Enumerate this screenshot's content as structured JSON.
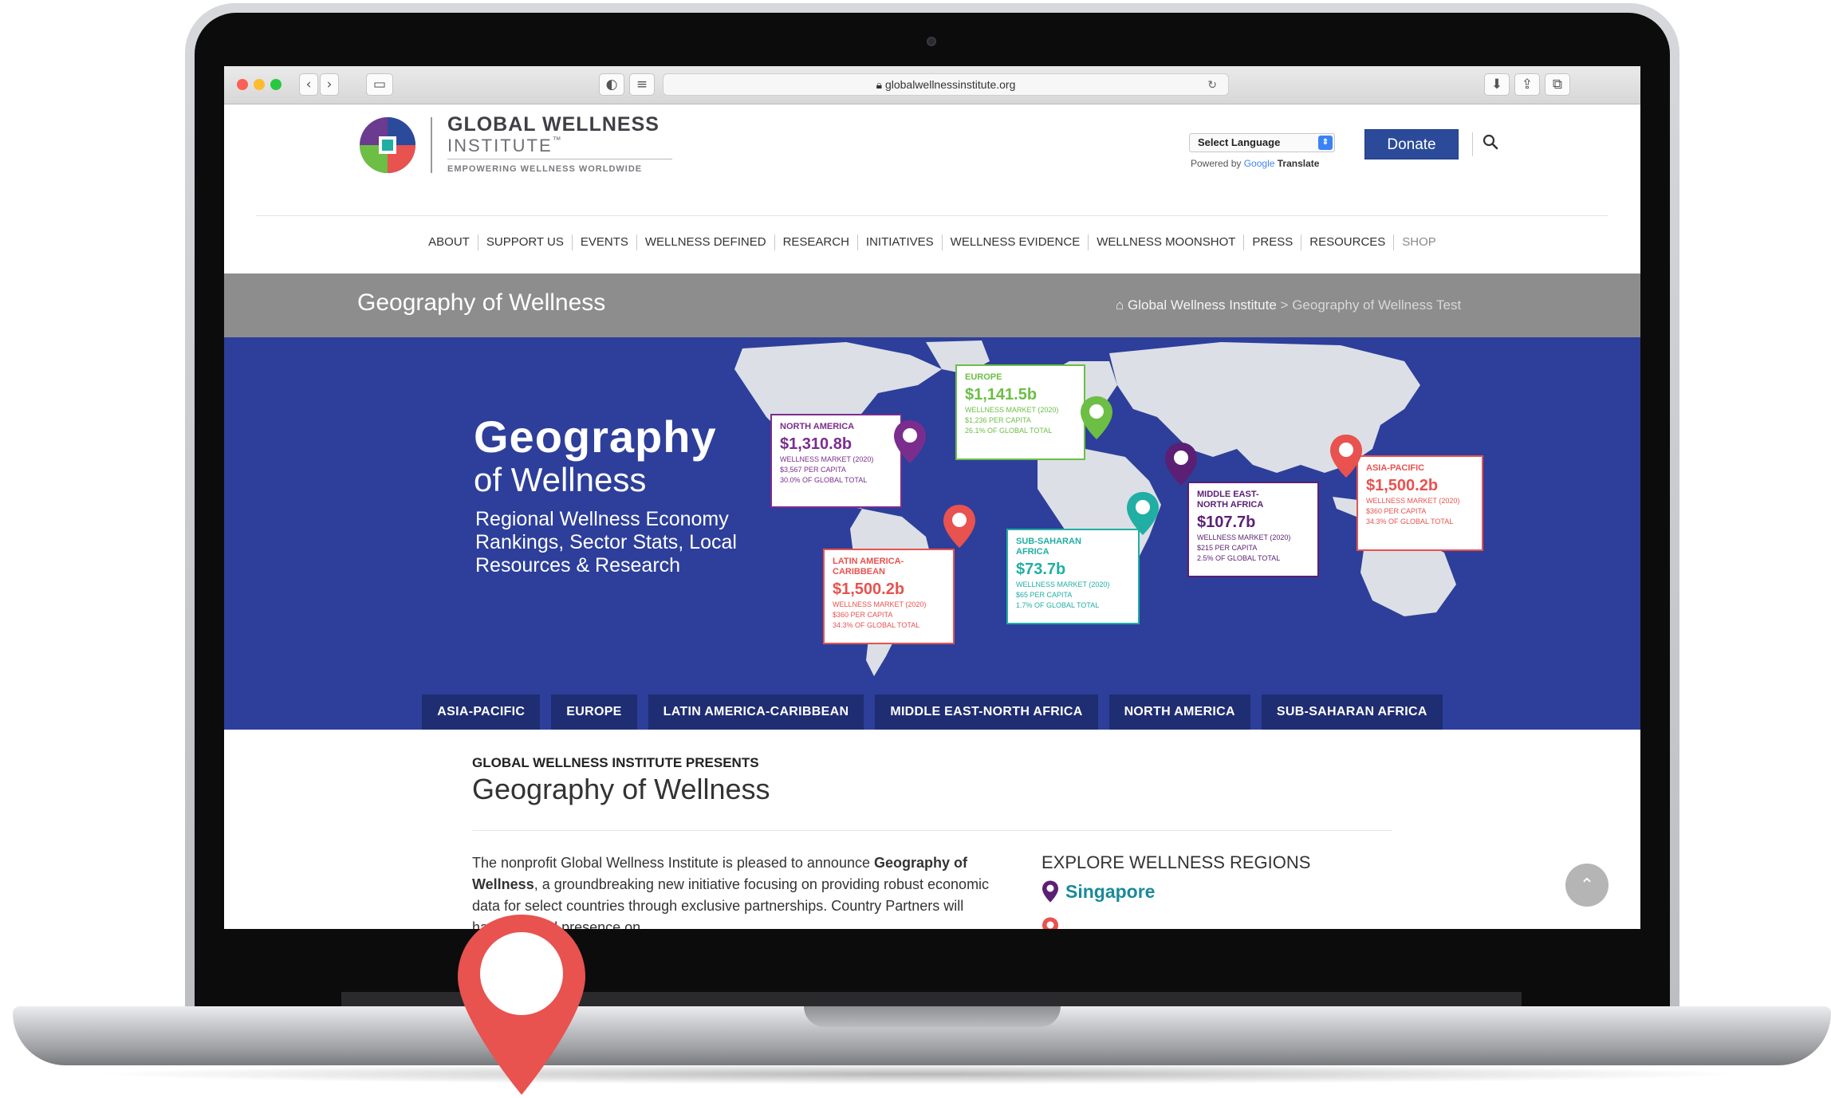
{
  "browser": {
    "url": "globalwellnessinstitute.org"
  },
  "header": {
    "logo_title": "GLOBAL WELLNESS",
    "logo_sub": "INSTITUTE",
    "logo_trademark": "™",
    "tagline": "EMPOWERING WELLNESS WORLDWIDE",
    "language_select": "Select Language",
    "powered_by": "Powered by",
    "google": "Google",
    "translate": "Translate",
    "donate": "Donate"
  },
  "nav": [
    "ABOUT",
    "SUPPORT US",
    "EVENTS",
    "WELLNESS DEFINED",
    "RESEARCH",
    "INITIATIVES",
    "WELLNESS EVIDENCE",
    "WELLNESS MOONSHOT",
    "PRESS",
    "RESOURCES",
    "SHOP"
  ],
  "title_bar": {
    "title": "Geography of Wellness",
    "crumb_home": "Global Wellness Institute",
    "crumb_sep": ">",
    "crumb_current": "Geography of Wellness Test"
  },
  "hero": {
    "title": "Geography",
    "subtitle": "of Wellness",
    "description": "Regional Wellness Economy Rankings, Sector Stats, Local Resources & Research",
    "cards": [
      {
        "region": "NORTH AMERICA",
        "amount": "$1,310.8b",
        "market": "WELLNESS MARKET (2020)",
        "per_capita": "$3,567 PER CAPITA",
        "share": "30.0% OF GLOBAL TOTAL",
        "color": "#7b2d8e"
      },
      {
        "region": "EUROPE",
        "amount": "$1,141.5b",
        "market": "WELLNESS MARKET (2020)",
        "per_capita": "$1,236 PER CAPITA",
        "share": "26.1% OF GLOBAL TOTAL",
        "color": "#6cbe45"
      },
      {
        "region": "MIDDLE EAST-NORTH AFRICA",
        "amount": "$107.7b",
        "market": "WELLNESS MARKET (2020)",
        "per_capita": "$215 PER CAPITA",
        "share": "2.5% OF GLOBAL TOTAL",
        "color": "#5b1f74"
      },
      {
        "region": "ASIA-PACIFIC",
        "amount": "$1,500.2b",
        "market": "WELLNESS MARKET (2020)",
        "per_capita": "$360 PER CAPITA",
        "share": "34.3% OF GLOBAL TOTAL",
        "color": "#e8524f"
      },
      {
        "region": "LATIN AMERICA-CARIBBEAN",
        "amount": "$1,500.2b",
        "market": "WELLNESS MARKET (2020)",
        "per_capita": "$360 PER CAPITA",
        "share": "34.3% OF GLOBAL TOTAL",
        "color": "#e8524f"
      },
      {
        "region": "SUB-SAHARAN AFRICA",
        "amount": "$73.7b",
        "market": "WELLNESS MARKET (2020)",
        "per_capita": "$65 PER CAPITA",
        "share": "1.7% OF GLOBAL TOTAL",
        "color": "#21aea4"
      }
    ],
    "tabs": [
      "ASIA-PACIFIC",
      "EUROPE",
      "LATIN AMERICA-CARIBBEAN",
      "MIDDLE EAST-NORTH AFRICA",
      "NORTH AMERICA",
      "SUB-SAHARAN AFRICA"
    ]
  },
  "content": {
    "presents": "GLOBAL WELLNESS INSTITUTE PRESENTS",
    "title": "Geography of Wellness",
    "intro_prefix": "The nonprofit Global Wellness Institute is pleased to announce ",
    "intro_bold": "Geography of Wellness",
    "intro_suffix": ", a groundbreaking new initiative focusing on providing robust economic data for select countries through exclusive partnerships. Country Partners will have a global presence on",
    "explore_title": "EXPLORE WELLNESS REGIONS",
    "explore_first": "Singapore"
  },
  "colors": {
    "hero_bg": "#2d3f9a",
    "tab_bg": "#1f2d72",
    "donate_bg": "#2b4b9a",
    "title_bar_bg": "#8d8d8d",
    "pin_red": "#e8524f"
  }
}
